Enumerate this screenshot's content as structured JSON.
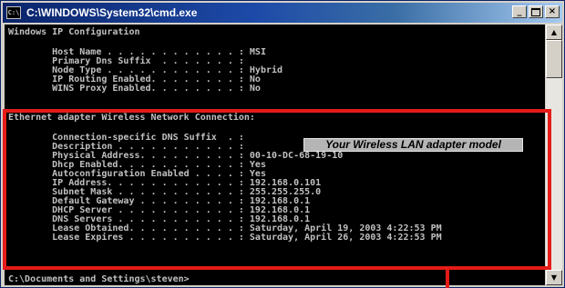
{
  "window": {
    "title": "C:\\WINDOWS\\System32\\cmd.exe",
    "title_icon_text": "C:\\",
    "minimize_glyph": "_",
    "close_glyph": "×"
  },
  "console": {
    "lines": [
      "Windows IP Configuration",
      "",
      "        Host Name . . . . . . . . . . . . : MSI",
      "        Primary Dns Suffix  . . . . . . . :",
      "        Node Type . . . . . . . . . . . . : Hybrid",
      "        IP Routing Enabled. . . . . . . . : No",
      "        WINS Proxy Enabled. . . . . . . . : No",
      "",
      "Ethernet adapter Wireless Network Connection:",
      "",
      "        Connection-specific DNS Suffix  . :",
      "        Description . . . . . . . . . . . :",
      "        Physical Address. . . . . . . . . : 00-10-DC-68-19-10",
      "        Dhcp Enabled. . . . . . . . . . . : Yes",
      "        Autoconfiguration Enabled . . . . : Yes",
      "        IP Address. . . . . . . . . . . . : 192.168.0.101",
      "        Subnet Mask . . . . . . . . . . . : 255.255.255.0",
      "        Default Gateway . . . . . . . . . : 192.168.0.1",
      "        DHCP Server . . . . . . . . . . . : 192.168.0.1",
      "        DNS Servers . . . . . . . . . . . : 192.168.0.1",
      "        Lease Obtained. . . . . . . . . . : Saturday, April 19, 2003 4:22:53 PM",
      "        Lease Expires . . . . . . . . . . : Saturday, April 26, 2003 4:22:53 PM",
      "",
      "C:\\Documents and Settings\\steven>"
    ]
  },
  "annotation": {
    "label": "Your Wireless LAN adapter model",
    "highlight_color": "#e41b17"
  },
  "scrollbar": {
    "up_glyph": "▲",
    "down_glyph": "▼"
  }
}
